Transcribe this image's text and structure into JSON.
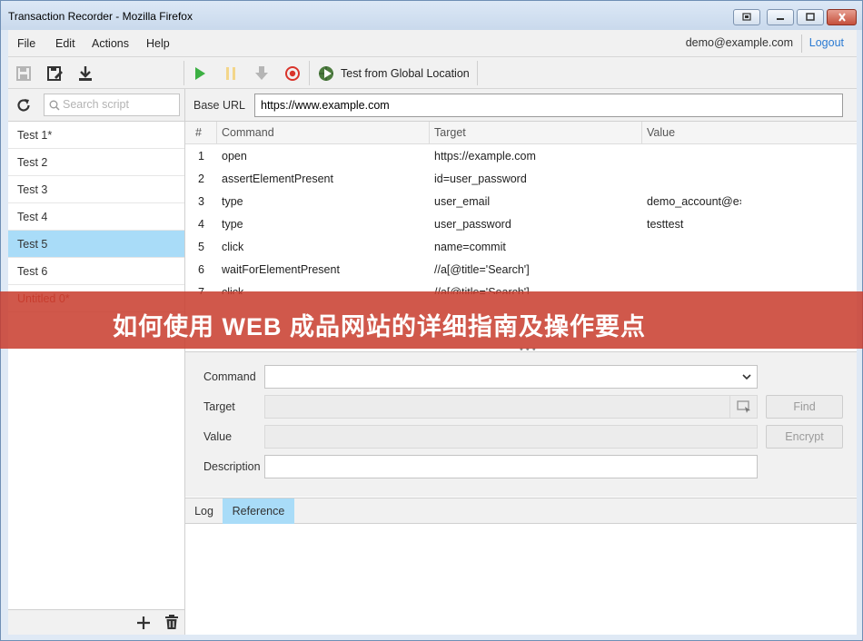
{
  "window": {
    "title": "Transaction Recorder - Mozilla Firefox"
  },
  "menu": {
    "items": [
      "File",
      "Edit",
      "Actions",
      "Help"
    ],
    "user_email": "demo@example.com",
    "logout": "Logout"
  },
  "toolbar": {
    "global_label": "Test from Global Location",
    "icons": [
      "save-icon",
      "save-as-icon",
      "download-icon",
      "play-icon",
      "pause-icon",
      "step-icon",
      "record-icon",
      "play-global-icon"
    ]
  },
  "sidebar": {
    "search_placeholder": "Search script",
    "tests": [
      {
        "label": "Test 1*"
      },
      {
        "label": "Test 2"
      },
      {
        "label": "Test 3"
      },
      {
        "label": "Test 4"
      },
      {
        "label": "Test 5"
      },
      {
        "label": "Test 6"
      },
      {
        "label": "Untitled 0*"
      }
    ],
    "selected_index": 4
  },
  "main": {
    "base_url_label": "Base URL",
    "base_url": "https://www.example.com",
    "columns": {
      "num": "#",
      "command": "Command",
      "target": "Target",
      "value": "Value"
    },
    "rows": [
      {
        "num": "1",
        "command": "open",
        "target": "https://example.com",
        "value": ""
      },
      {
        "num": "2",
        "command": "assertElementPresent",
        "target": "id=user_password",
        "value": ""
      },
      {
        "num": "3",
        "command": "type",
        "target": "user_email",
        "value": "demo_account@e›"
      },
      {
        "num": "4",
        "command": "type",
        "target": "user_password",
        "value": "testtest"
      },
      {
        "num": "5",
        "command": "click",
        "target": "name=commit",
        "value": ""
      },
      {
        "num": "6",
        "command": "waitForElementPresent",
        "target": "//a[@title='Search']",
        "value": ""
      },
      {
        "num": "7",
        "command": "click",
        "target": "//a[@title='Search']",
        "value": ""
      }
    ],
    "divider": "• • •"
  },
  "editor": {
    "command_label": "Command",
    "target_label": "Target",
    "value_label": "Value",
    "description_label": "Description",
    "find_label": "Find",
    "encrypt_label": "Encrypt"
  },
  "bottom_tabs": {
    "log": "Log",
    "reference": "Reference",
    "active": "Reference"
  },
  "overlay": {
    "banner_text": "如何使用 WEB 成品网站的详细指南及操作要点"
  },
  "colors": {
    "selection": "#a9dcf8",
    "accent_link": "#2a7ad2",
    "play_green": "#3cb043",
    "record_red": "#d9342b",
    "banner": "#c83c2d"
  }
}
